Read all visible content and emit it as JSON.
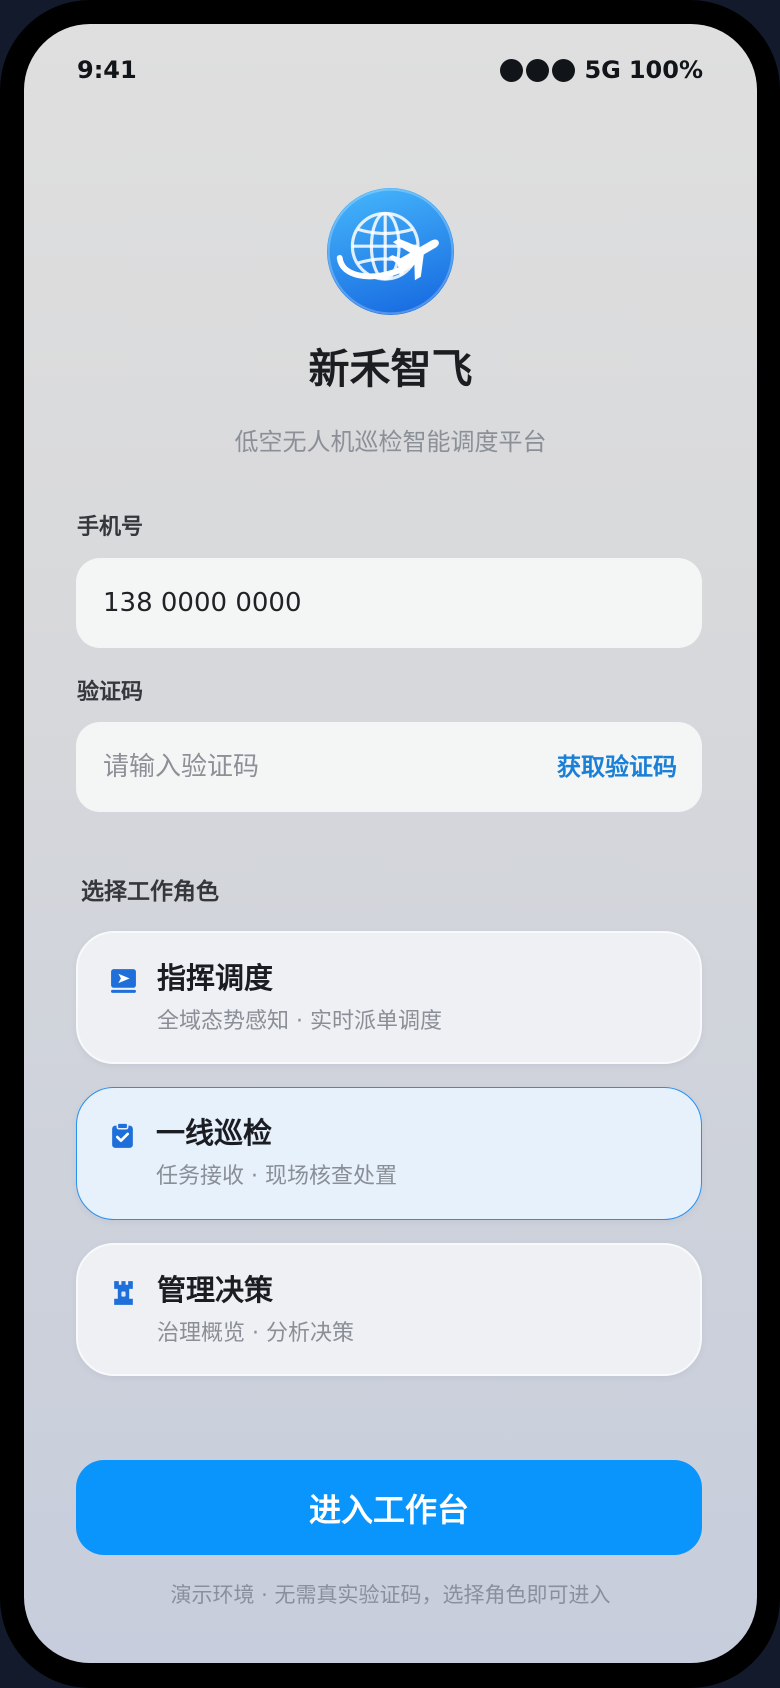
{
  "status_bar": {
    "time": "9:41",
    "signal_icon": "signal-dots-icon",
    "network": "5G",
    "battery": "100%"
  },
  "brand": {
    "logo_icon": "globe-airplane-icon",
    "name": "新禾智飞",
    "tagline": "低空无人机巡检智能调度平台"
  },
  "form": {
    "phone": {
      "label": "手机号",
      "value": "138 0000 0000"
    },
    "code": {
      "label": "验证码",
      "placeholder": "请输入验证码",
      "action_label": "获取验证码"
    }
  },
  "roles": {
    "heading": "选择工作角色",
    "items": [
      {
        "icon": "dispatch-icon",
        "title": "指挥调度",
        "subtitle": "全域态势感知 · 实时派单调度",
        "selected": false
      },
      {
        "icon": "clipboard-check-icon",
        "title": "一线巡检",
        "subtitle": "任务接收 · 现场核查处置",
        "selected": true
      },
      {
        "icon": "tower-icon",
        "title": "管理决策",
        "subtitle": "治理概览 · 分析决策",
        "selected": false
      }
    ]
  },
  "primary_action": {
    "label": "进入工作台"
  },
  "footnote": "演示环境 · 无需真实验证码，选择角色即可进入",
  "colors": {
    "accent": "#0a95fd",
    "link": "#1a7fd6",
    "selected_border": "#2790f0",
    "selected_bg": "#e7f1fc",
    "icon": "#1e6fd9",
    "page_background": "#131a2b"
  }
}
